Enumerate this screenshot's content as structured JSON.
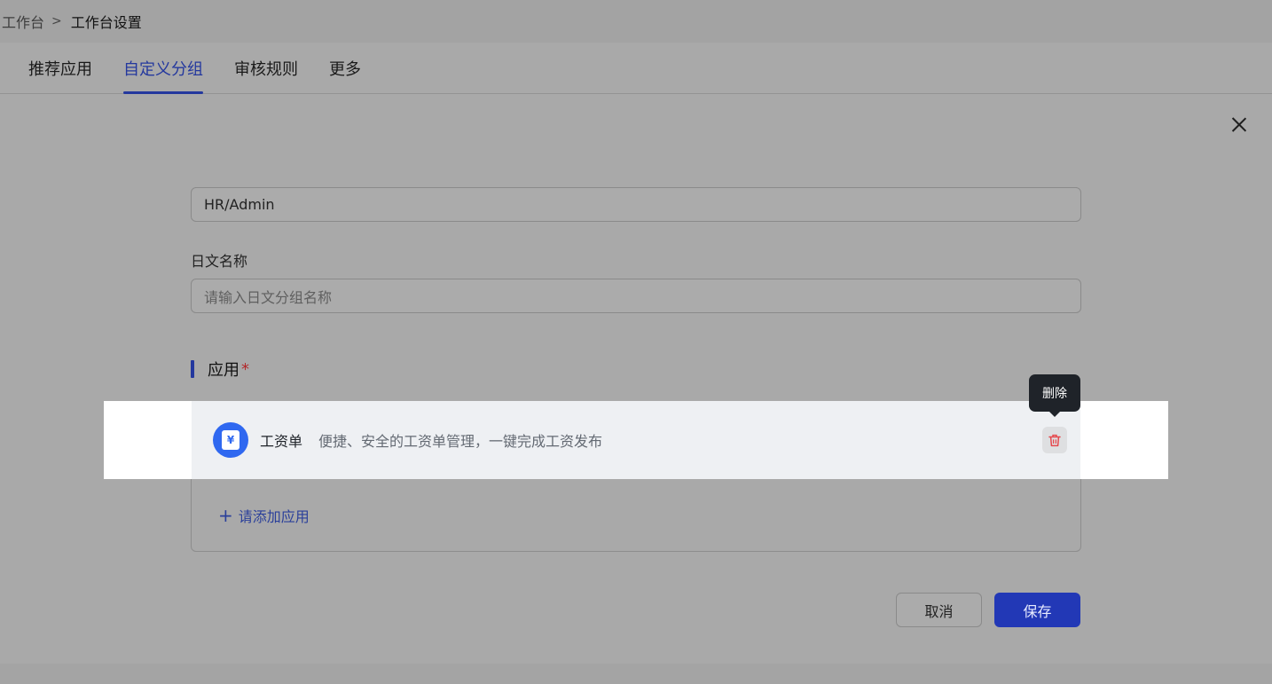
{
  "breadcrumb": {
    "root": "工作台",
    "separator": ">",
    "current": "工作台设置"
  },
  "tabs": [
    {
      "label": "推荐应用",
      "active": false
    },
    {
      "label": "自定义分组",
      "active": true
    },
    {
      "label": "审核规则",
      "active": false
    },
    {
      "label": "更多",
      "active": false
    }
  ],
  "form": {
    "group_name_value": "HR/Admin",
    "japanese_name_label": "日文名称",
    "japanese_name_placeholder": "请输入日文分组名称",
    "apps_section_title": "应用",
    "required_mark": "*"
  },
  "apps": [
    {
      "name": "工资单",
      "description": "便捷、安全的工资单管理，一键完成工资发布",
      "icon": "payroll-icon",
      "icon_glyph": "¥"
    }
  ],
  "tooltip": {
    "text": "删除"
  },
  "add_app": {
    "plus": "+",
    "label": "请添加应用"
  },
  "actions": {
    "cancel": "取消",
    "save": "保存"
  },
  "colors": {
    "accent": "#24389e",
    "primary_button": "#2238b6",
    "app_icon": "#2f68f0",
    "delete_icon": "#e5484d"
  }
}
